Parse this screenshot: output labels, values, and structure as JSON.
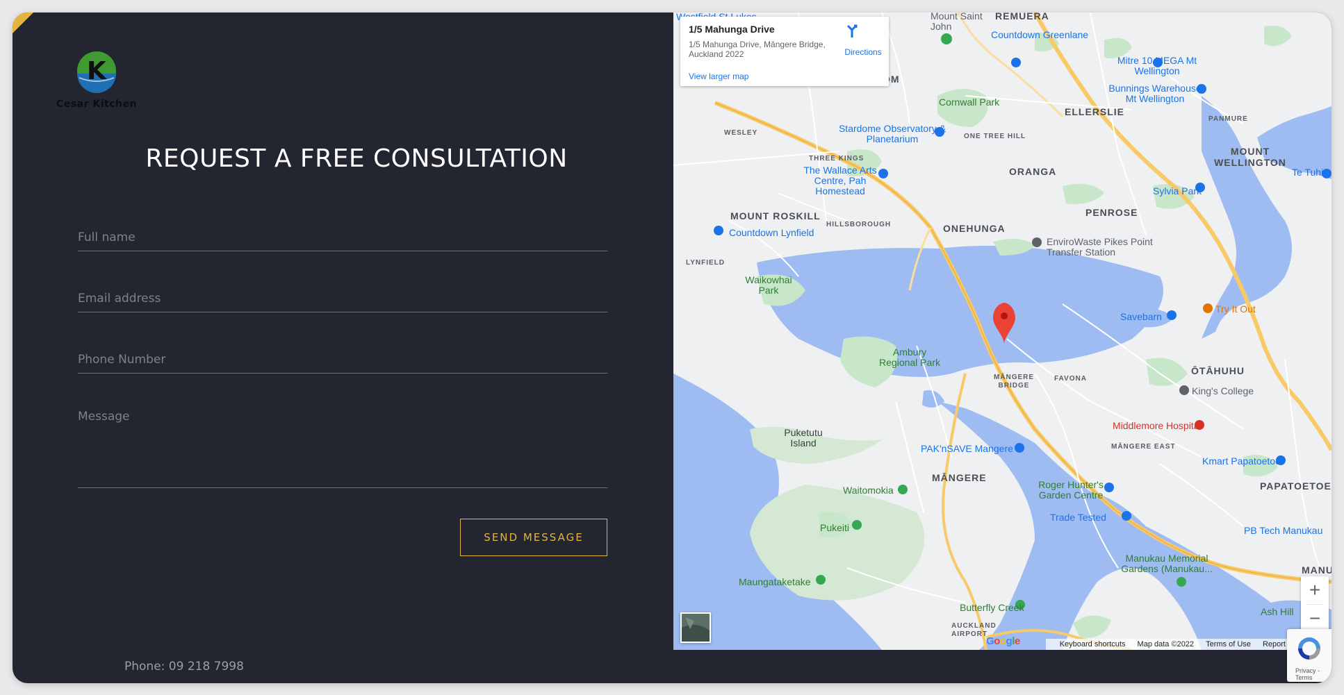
{
  "brand": {
    "logo_letter": "K",
    "logo_text": "Cesar Kitchen"
  },
  "form": {
    "title": "REQUEST A FREE CONSULTATION",
    "full_name_placeholder": "Full name",
    "email_placeholder": "Email address",
    "phone_placeholder": "Phone Number",
    "message_placeholder": "Message",
    "send_label": "SEND MESSAGE"
  },
  "contact": {
    "phone": "Phone: 09 218 7998"
  },
  "map": {
    "info_title": "1/5 Mahunga Drive",
    "info_address": "1/5 Mahunga Drive, Māngere Bridge, Auckland 2022",
    "view_larger": "View larger map",
    "directions": "Directions",
    "zoom_in": "+",
    "zoom_out": "−",
    "footer": {
      "shortcuts": "Keyboard shortcuts",
      "map_data": "Map data ©2022",
      "terms": "Terms of Use",
      "report": "Report"
    },
    "google": "Google",
    "labels": {
      "westfield": "Westfield St Lukes",
      "mount_saint_john": "Mount Saint John",
      "remuera": "REMUERA",
      "countdown_greenlane": "Countdown Greenlane",
      "epsom": "EPSOM",
      "mitre10": "Mitre 10 MEGA Mt Wellington",
      "bunnings": "Bunnings Warehouse Mt Wellington",
      "cornwall_park": "Cornwall Park",
      "ellerslie": "ELLERSLIE",
      "wesley": "WESLEY",
      "stardome": "Stardome Observatory & Planetarium",
      "one_tree_hill": "ONE TREE HILL",
      "panmure": "PANMURE",
      "mount_wellington": "MOUNT WELLINGTON",
      "three_kings": "THREE KINGS",
      "oranga": "ORANGA",
      "wallace_arts": "The Wallace Arts Centre, Pah Homestead",
      "sylvia_park": "Sylvia Park",
      "te_tuhi": "Te Tuhi",
      "mount_roskill": "MOUNT ROSKILL",
      "hillsborough": "HILLSBOROUGH",
      "onehunga": "ONEHUNGA",
      "penrose": "PENROSE",
      "countdown_lynfield": "Countdown Lynfield",
      "envirowaste": "EnviroWaste Pikes Point Transfer Station",
      "lynfield": "LYNFIELD",
      "waikowhai_park": "Waikowhai Park",
      "try_it_out": "Try It Out",
      "savebarn": "Savebarn",
      "ambury": "Ambury Regional Park",
      "mangere_bridge": "MĀNGERE BRIDGE",
      "favona": "FAVONA",
      "otahuhu": "ŌTĀHUHU",
      "kings_college": "King's College",
      "middlemore": "Middlemore Hospital",
      "puketutu": "Puketutu Island",
      "paknsave": "PAK'nSAVE Mangere",
      "mangere_east": "MĀNGERE EAST",
      "kmart": "Kmart Papatoetoe",
      "mangere": "MĀNGERE",
      "papatoetoe": "PAPATOETOE",
      "waitomokia": "Waitomokia",
      "roger_hunter": "Roger Hunter's Garden Centre",
      "trade_tested": "Trade Tested",
      "pb_tech": "PB Tech Manukau",
      "pukeiti": "Pukeiti",
      "manukau_memorial": "Manukau Memorial Gardens (Manukau...",
      "maungataketake": "Maungataketake",
      "manu": "MANU",
      "butterfly_creek": "Butterfly Creek",
      "ash_hill": "Ash Hill",
      "auckland_airport": "AUCKLAND AIRPORT"
    }
  },
  "recaptcha": {
    "text": "Privacy - Terms"
  },
  "colors": {
    "panel": "#232631",
    "accent": "#e0b43e",
    "water": "#9ebcf2",
    "green": "#c8e6c9"
  }
}
